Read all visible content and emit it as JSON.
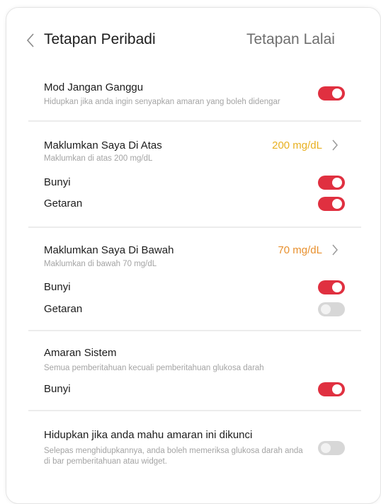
{
  "header": {
    "title": "Tetapan Peribadi",
    "default_button": "Tetapan Lalai"
  },
  "colors": {
    "toggle_on": "#e03040",
    "toggle_off": "#d7d7d7",
    "high_value": "#e8b020",
    "low_value": "#e8902e"
  },
  "dnd": {
    "title": "Mod Jangan Ganggu",
    "subtitle": "Hidupkan jika anda ingin senyapkan amaran yang boleh didengar",
    "enabled": true
  },
  "high_alert": {
    "title": "Maklumkan Saya Di Atas",
    "subtitle": "Maklumkan di atas 200 mg/dL",
    "value": "200 mg/dL",
    "sound_label": "Bunyi",
    "sound_enabled": true,
    "vibration_label": "Getaran",
    "vibration_enabled": true
  },
  "low_alert": {
    "title": "Maklumkan Saya Di Bawah",
    "subtitle": "Maklumkan di bawah 70 mg/dL",
    "value": "70 mg/dL",
    "sound_label": "Bunyi",
    "sound_enabled": true,
    "vibration_label": "Getaran",
    "vibration_enabled": false
  },
  "system_alert": {
    "title": "Amaran Sistem",
    "subtitle": "Semua pemberitahuan kecuali pemberitahuan glukosa darah",
    "sound_label": "Bunyi",
    "sound_enabled": true
  },
  "lockscreen": {
    "title": "Hidupkan jika anda mahu amaran ini dikunci",
    "subtitle": "Selepas menghidupkannya, anda boleh memeriksa glukosa darah anda di bar pemberitahuan atau widget.",
    "enabled": false
  }
}
